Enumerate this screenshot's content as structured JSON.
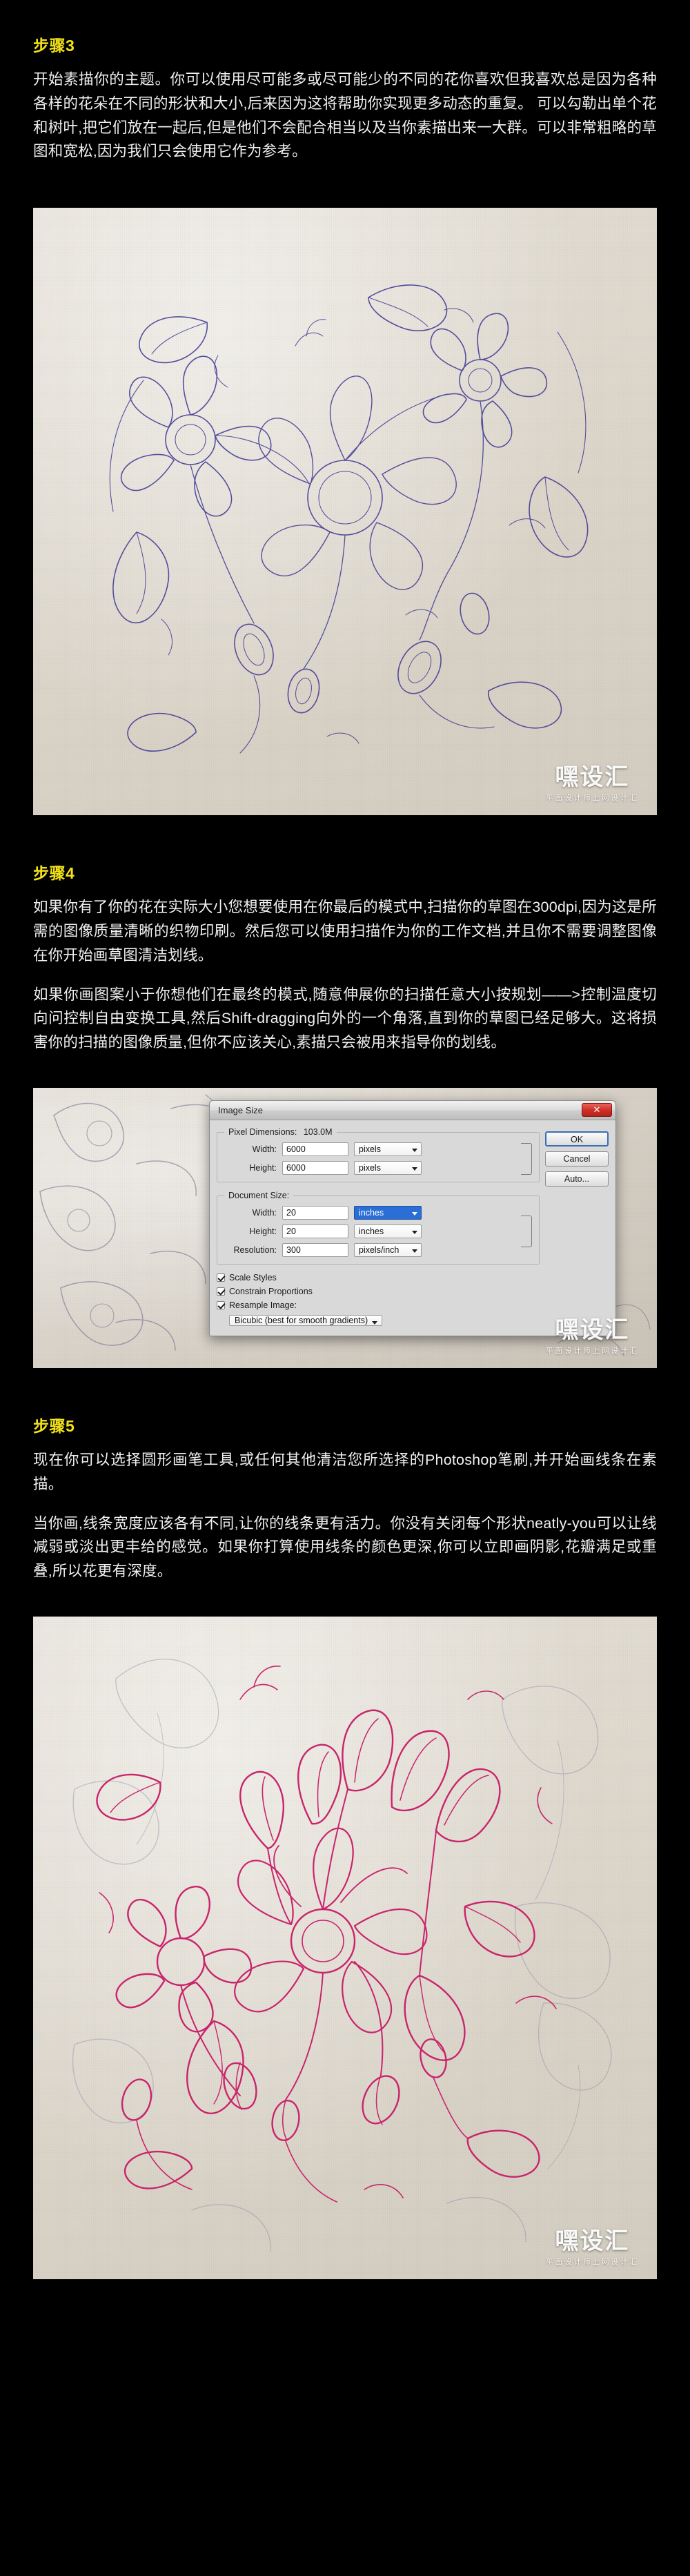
{
  "page": {
    "background_color": "#000000",
    "heading_color": "#f2e21a",
    "body_text_color": "#f0f0f0"
  },
  "sections": [
    {
      "id": "step3",
      "title": "步骤3",
      "paragraphs": [
        "开始素描你的主题。你可以使用尽可能多或尽可能少的不同的花你喜欢但我喜欢总是因为各种各样的花朵在不同的形状和大小,后来因为这将帮助你实现更多动态的重复。 可以勾勒出单个花和树叶,把它们放在一起后,但是他们不会配合相当以及当你素描出来一大群。可以非常粗略的草图和宽松,因为我们只会使用它作为参考。"
      ]
    },
    {
      "id": "step4",
      "title": "步骤4",
      "paragraphs": [
        "如果你有了你的花在实际大小您想要使用在你最后的模式中,扫描你的草图在300dpi,因为这是所需的图像质量清晰的织物印刷。然后您可以使用扫描作为你的工作文档,并且你不需要调整图像在你开始画草图清洁划线。",
        "如果你画图案小于你想他们在最终的模式,随意伸展你的扫描任意大小按规划——>控制温度切向问控制自由变换工具,然后Shift-dragging向外的一个角落,直到你的草图已经足够大。这将损害你的扫描的图像质量,但你不应该关心,素描只会被用来指导你的划线。"
      ]
    },
    {
      "id": "step5",
      "title": "步骤5",
      "paragraphs": [
        "现在你可以选择圆形画笔工具,或任何其他清洁您所选择的Photoshop笔刷,并开始画线条在素描。",
        "当你画,线条宽度应该各有不同,让你的线条更有活力。你没有关闭每个形状neatly-you可以让线减弱或淡出更丰给的感觉。如果你打算使用线条的颜色更深,你可以立即画阴影,花瓣满足或重叠,所以花更有深度。"
      ]
    }
  ],
  "images": {
    "sketch_blue": {
      "alt_name": "blue-pen-floral-sketch",
      "paper_color": "#ded8cd",
      "ink_color": "#474196"
    },
    "photoshop_dialog_shot": {
      "alt_name": "photoshop-image-size-dialog-screenshot",
      "paper_color": "#d8d2c8"
    },
    "sketch_pink": {
      "alt_name": "pink-ink-floral-lineart",
      "paper_color": "#e3ded5",
      "ink_color": "#c9246b"
    }
  },
  "watermark": {
    "main": "嘿设汇",
    "sub": "平面设计师上网设计汇"
  },
  "photoshop_dialog": {
    "title": "Image Size",
    "close_label": "✕",
    "buttons": {
      "ok": "OK",
      "cancel": "Cancel",
      "auto": "Auto..."
    },
    "pixel_dimensions": {
      "legend": "Pixel Dimensions:",
      "size": "103.0M",
      "rows": [
        {
          "label": "Width:",
          "value": "6000",
          "unit": "pixels"
        },
        {
          "label": "Height:",
          "value": "6000",
          "unit": "pixels"
        }
      ]
    },
    "document_size": {
      "legend": "Document Size:",
      "rows": [
        {
          "label": "Width:",
          "value": "20",
          "unit": "inches",
          "highlight": true
        },
        {
          "label": "Height:",
          "value": "20",
          "unit": "inches",
          "highlight": false
        },
        {
          "label": "Resolution:",
          "value": "300",
          "unit": "pixels/inch",
          "highlight": false
        }
      ]
    },
    "options": [
      {
        "label": "Scale Styles",
        "checked": true
      },
      {
        "label": "Constrain Proportions",
        "checked": true
      },
      {
        "label": "Resample Image:",
        "checked": true
      }
    ],
    "resample_method": "Bicubic (best for smooth gradients)"
  }
}
